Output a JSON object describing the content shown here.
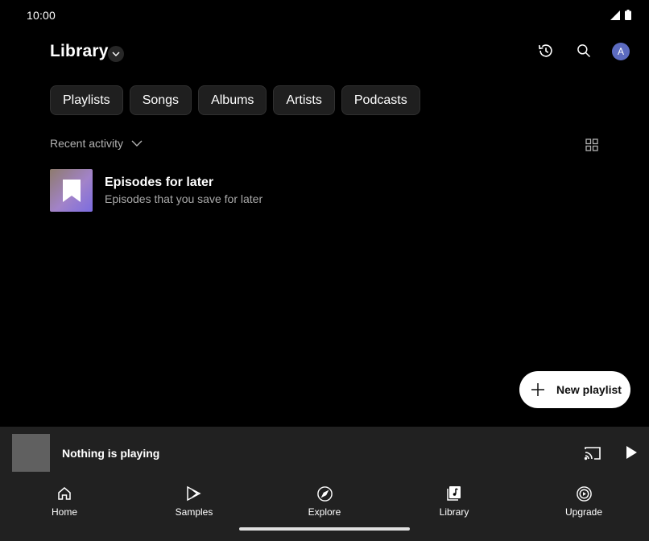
{
  "status": {
    "time": "10:00"
  },
  "header": {
    "title": "Library",
    "avatar_letter": "A"
  },
  "chips": [
    "Playlists",
    "Songs",
    "Albums",
    "Artists",
    "Podcasts"
  ],
  "sort": {
    "label": "Recent activity"
  },
  "items": [
    {
      "title": "Episodes for later",
      "subtitle": "Episodes that you save for later",
      "icon": "bookmark-icon"
    }
  ],
  "fab": {
    "label": "New playlist"
  },
  "mini_player": {
    "title": "Nothing is playing"
  },
  "nav": [
    {
      "label": "Home",
      "icon": "home-icon"
    },
    {
      "label": "Samples",
      "icon": "samples-icon"
    },
    {
      "label": "Explore",
      "icon": "compass-icon"
    },
    {
      "label": "Library",
      "icon": "library-icon"
    },
    {
      "label": "Upgrade",
      "icon": "upgrade-icon"
    }
  ],
  "colors": {
    "background": "#000000",
    "surface": "#212121",
    "chip": "#1f1f1f",
    "avatar": "#5c6bc0"
  }
}
